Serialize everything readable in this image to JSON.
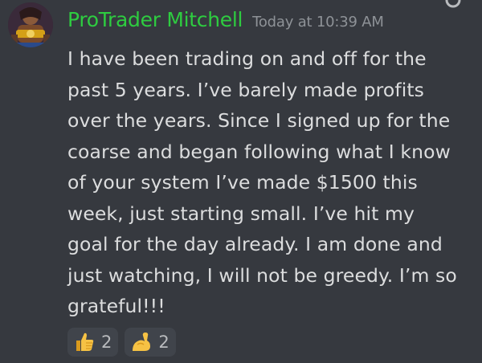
{
  "author": {
    "username": "ProTrader Mitchell",
    "timestamp": "Today at 10:39 AM",
    "username_color": "#2ecc40"
  },
  "message": {
    "lines": [
      "I have been trading on and off for the",
      "past 5 years.  I’ve barely made profits",
      "over the years.  Since I signed up for the",
      "coarse and began following what I know",
      "of  your system I’ve made $1500 this",
      "week, just starting small.  I’ve hit my",
      "goal for the day already. I am done and",
      "just watching, I will not be greedy. I’m so",
      "grateful!!!"
    ]
  },
  "reactions": [
    {
      "emoji": "thumbs-up-icon",
      "count": "2"
    },
    {
      "emoji": "flexed-biceps-icon",
      "count": "2"
    }
  ],
  "colors": {
    "background": "#36393f",
    "text": "#dcddde",
    "muted": "#8e9297",
    "reaction_bg": "#40444b"
  }
}
